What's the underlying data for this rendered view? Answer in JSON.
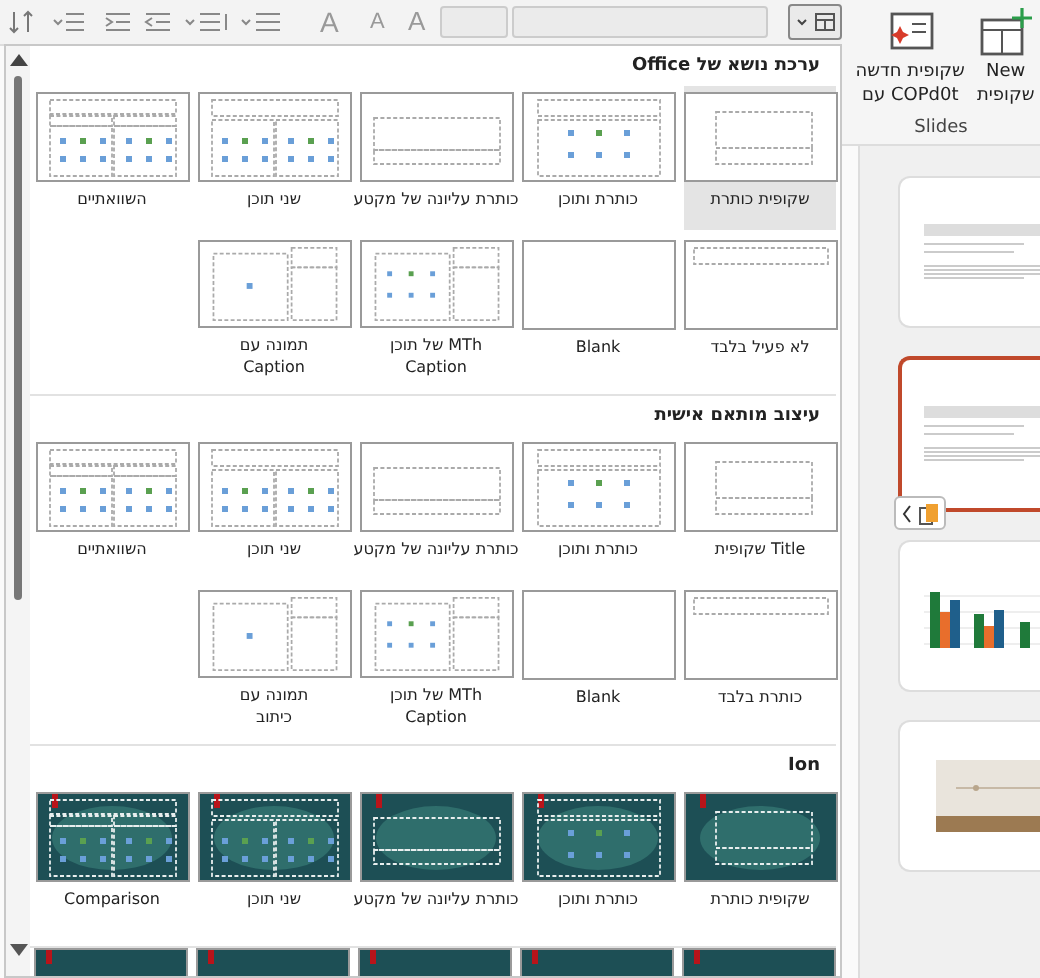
{
  "toolbar": {
    "glyphs": [
      "A",
      "A",
      "A"
    ]
  },
  "ribbon": {
    "buttons": [
      {
        "kind": "new",
        "lines": [
          "New",
          "שקופית"
        ]
      },
      {
        "kind": "copilot",
        "lines": [
          "שקופית חדשה",
          "עם COPd0t"
        ]
      }
    ],
    "group_label": "Slides"
  },
  "gallery": {
    "sections": [
      {
        "title": "ערכת נושא של Office",
        "kind": "office",
        "rows": [
          [
            {
              "kind": "title",
              "label": [
                "שקופית כותרת"
              ],
              "selected": true
            },
            {
              "kind": "title-content",
              "label": [
                "כותרת ותוכן"
              ],
              "selected": false
            },
            {
              "kind": "section",
              "label": [
                "כותרת עליונה של מקטע"
              ],
              "selected": false
            },
            {
              "kind": "two-content",
              "label": [
                "שני תוכן"
              ],
              "selected": false
            },
            {
              "kind": "comparison",
              "label": [
                "השוואתיים"
              ],
              "selected": false
            }
          ],
          [
            {
              "kind": "title-only",
              "label": [
                "לא פעיל בלבד"
              ],
              "selected": false
            },
            {
              "kind": "blank",
              "label": [
                "Blank"
              ],
              "selected": false
            },
            {
              "kind": "content-caption",
              "label": [
                "MTh של תוכן",
                "Caption"
              ],
              "selected": false
            },
            {
              "kind": "picture-caption",
              "label": [
                "תמונה עם",
                "Caption"
              ],
              "selected": false
            }
          ]
        ]
      },
      {
        "title": "עיצוב מותאם אישית",
        "kind": "office",
        "rows": [
          [
            {
              "kind": "title",
              "label": [
                "Title שקופית"
              ],
              "selected": false
            },
            {
              "kind": "title-content",
              "label": [
                "כותרת ותוכן"
              ],
              "selected": false
            },
            {
              "kind": "section",
              "label": [
                "כותרת עליונה של מקטע"
              ],
              "selected": false
            },
            {
              "kind": "two-content",
              "label": [
                "שני תוכן"
              ],
              "selected": false
            },
            {
              "kind": "comparison",
              "label": [
                "השוואתיים"
              ],
              "selected": false
            }
          ],
          [
            {
              "kind": "title-only",
              "label": [
                "כותרת בלבד"
              ],
              "selected": false
            },
            {
              "kind": "blank",
              "label": [
                "Blank"
              ],
              "selected": false
            },
            {
              "kind": "content-caption",
              "label": [
                "MTh של תוכן",
                "Caption"
              ],
              "selected": false
            },
            {
              "kind": "picture-caption",
              "label": [
                "תמונה עם",
                "כיתוב"
              ],
              "selected": false
            }
          ]
        ]
      },
      {
        "title": "Ion",
        "kind": "ion",
        "rows": [
          [
            {
              "kind": "title",
              "label": [
                "שקופית כותרת"
              ],
              "selected": false
            },
            {
              "kind": "title-content",
              "label": [
                "כותרת ותוכן"
              ],
              "selected": false
            },
            {
              "kind": "section",
              "label": [
                "כותרת עליונה של מקטע"
              ],
              "selected": false
            },
            {
              "kind": "two-content",
              "label": [
                "שני תוכן"
              ],
              "selected": false
            },
            {
              "kind": "comparison",
              "label": [
                "Comparison"
              ],
              "selected": false
            }
          ]
        ]
      }
    ]
  },
  "slides": [
    {
      "kind": "text",
      "selected": false
    },
    {
      "kind": "text",
      "selected": true
    },
    {
      "kind": "chart",
      "selected": false
    },
    {
      "kind": "picture",
      "selected": false
    }
  ]
}
